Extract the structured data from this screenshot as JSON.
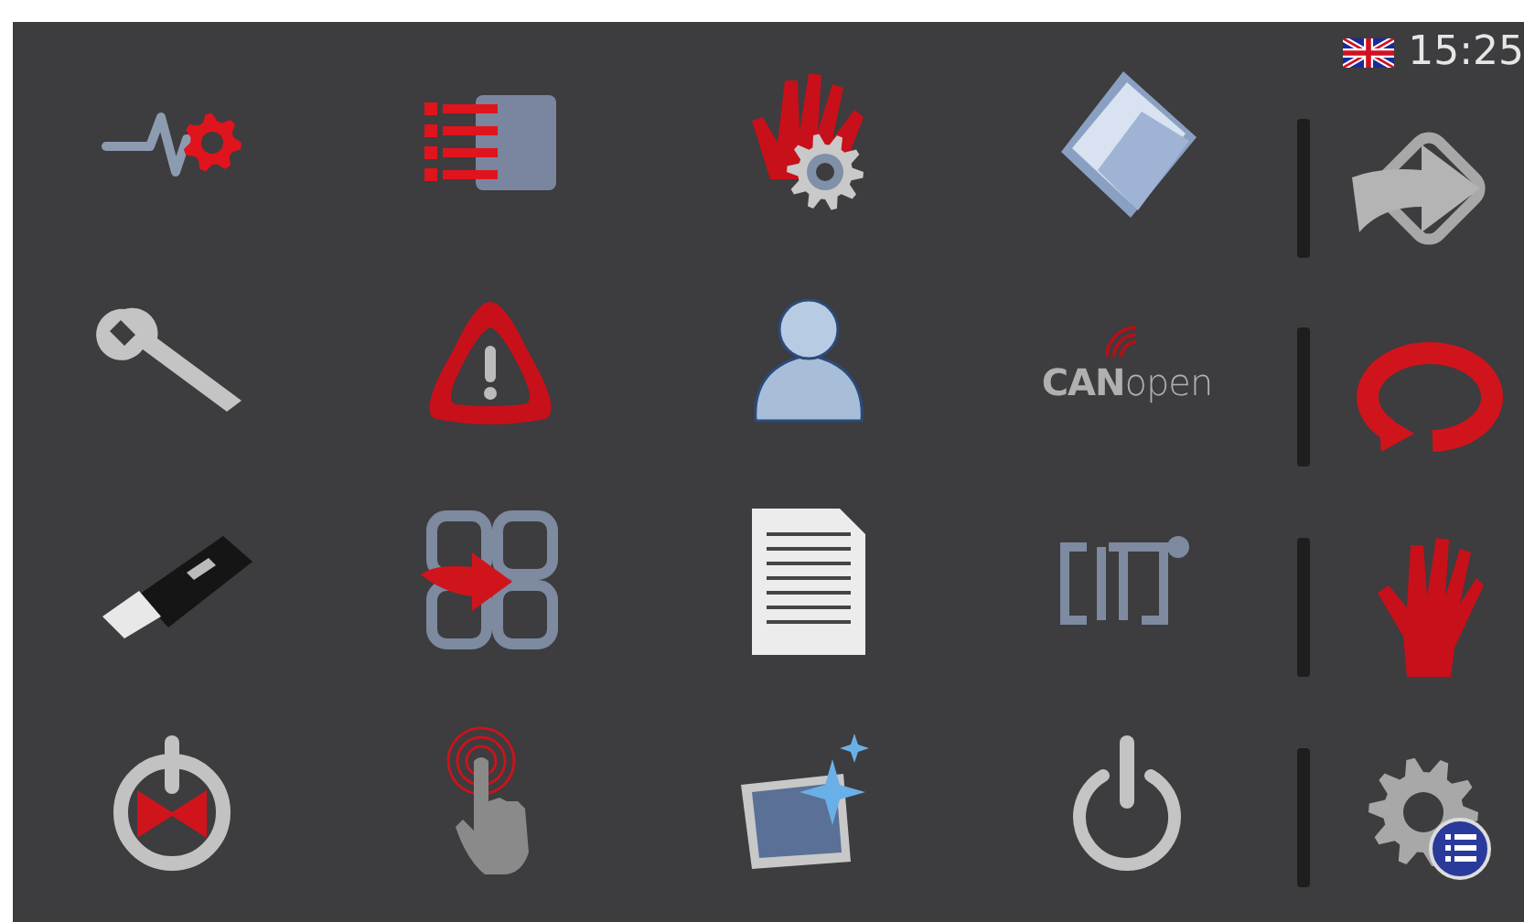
{
  "status_bar": {
    "time": "15:25"
  },
  "canopen_tile": {
    "label": "**CAN**open"
  }
}
